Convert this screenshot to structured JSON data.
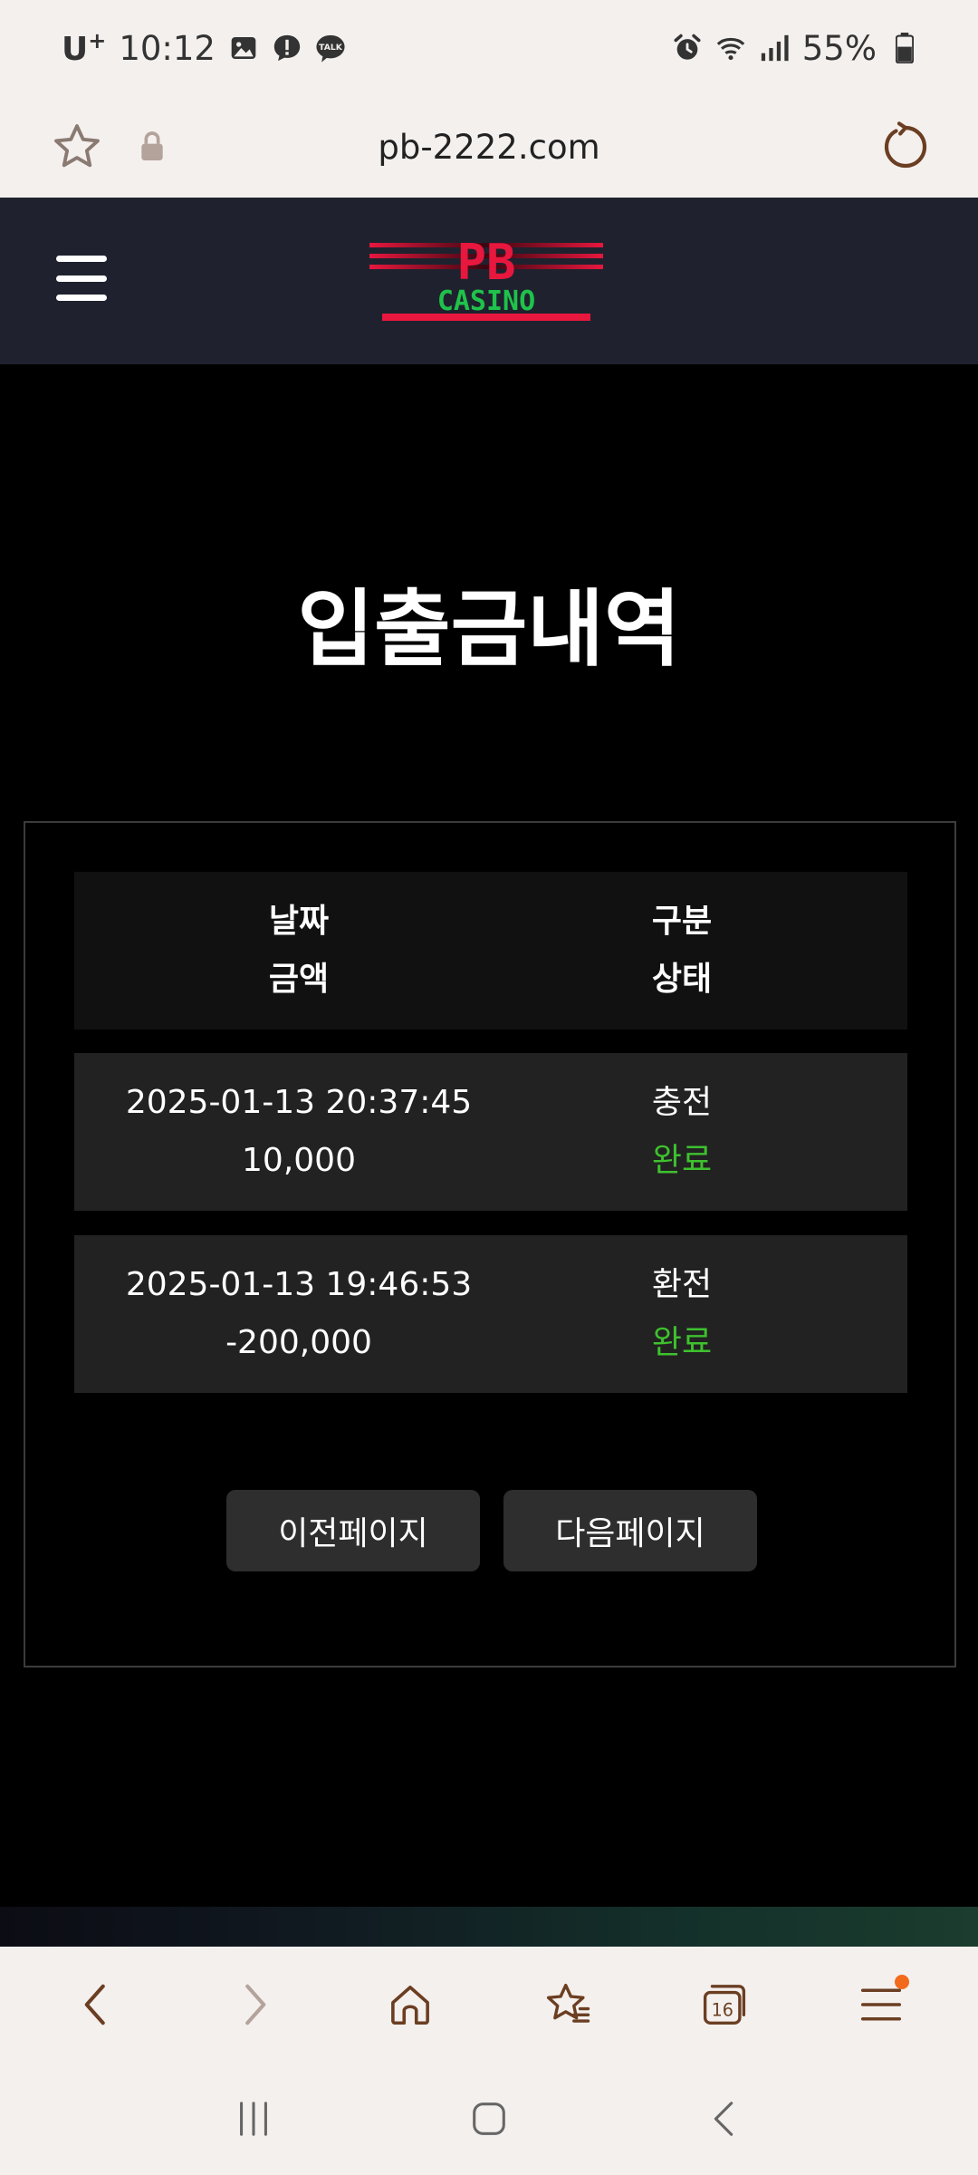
{
  "status_bar": {
    "carrier": "U",
    "carrier_plus": "+",
    "time": "10:12",
    "battery": "55%"
  },
  "browser": {
    "url": "pb-2222.com",
    "tab_count": "16"
  },
  "site": {
    "logo_top": "PB",
    "logo_bottom": "CASINO"
  },
  "page": {
    "title": "입출금내역"
  },
  "table": {
    "header": {
      "date": "날짜",
      "amount": "금액",
      "type": "구분",
      "status": "상태"
    },
    "rows": [
      {
        "date": "2025-01-13 20:37:45",
        "amount": "10,000",
        "type": "충전",
        "status": "완료"
      },
      {
        "date": "2025-01-13 19:46:53",
        "amount": "-200,000",
        "type": "환전",
        "status": "완료"
      }
    ]
  },
  "pager": {
    "prev_label": "이전페이지",
    "next_label": "다음페이지"
  },
  "colors": {
    "status_complete": "#3ec12e",
    "header_bg": "#1f222e",
    "logo_red": "#e8173e",
    "logo_green": "#1fc24a"
  }
}
